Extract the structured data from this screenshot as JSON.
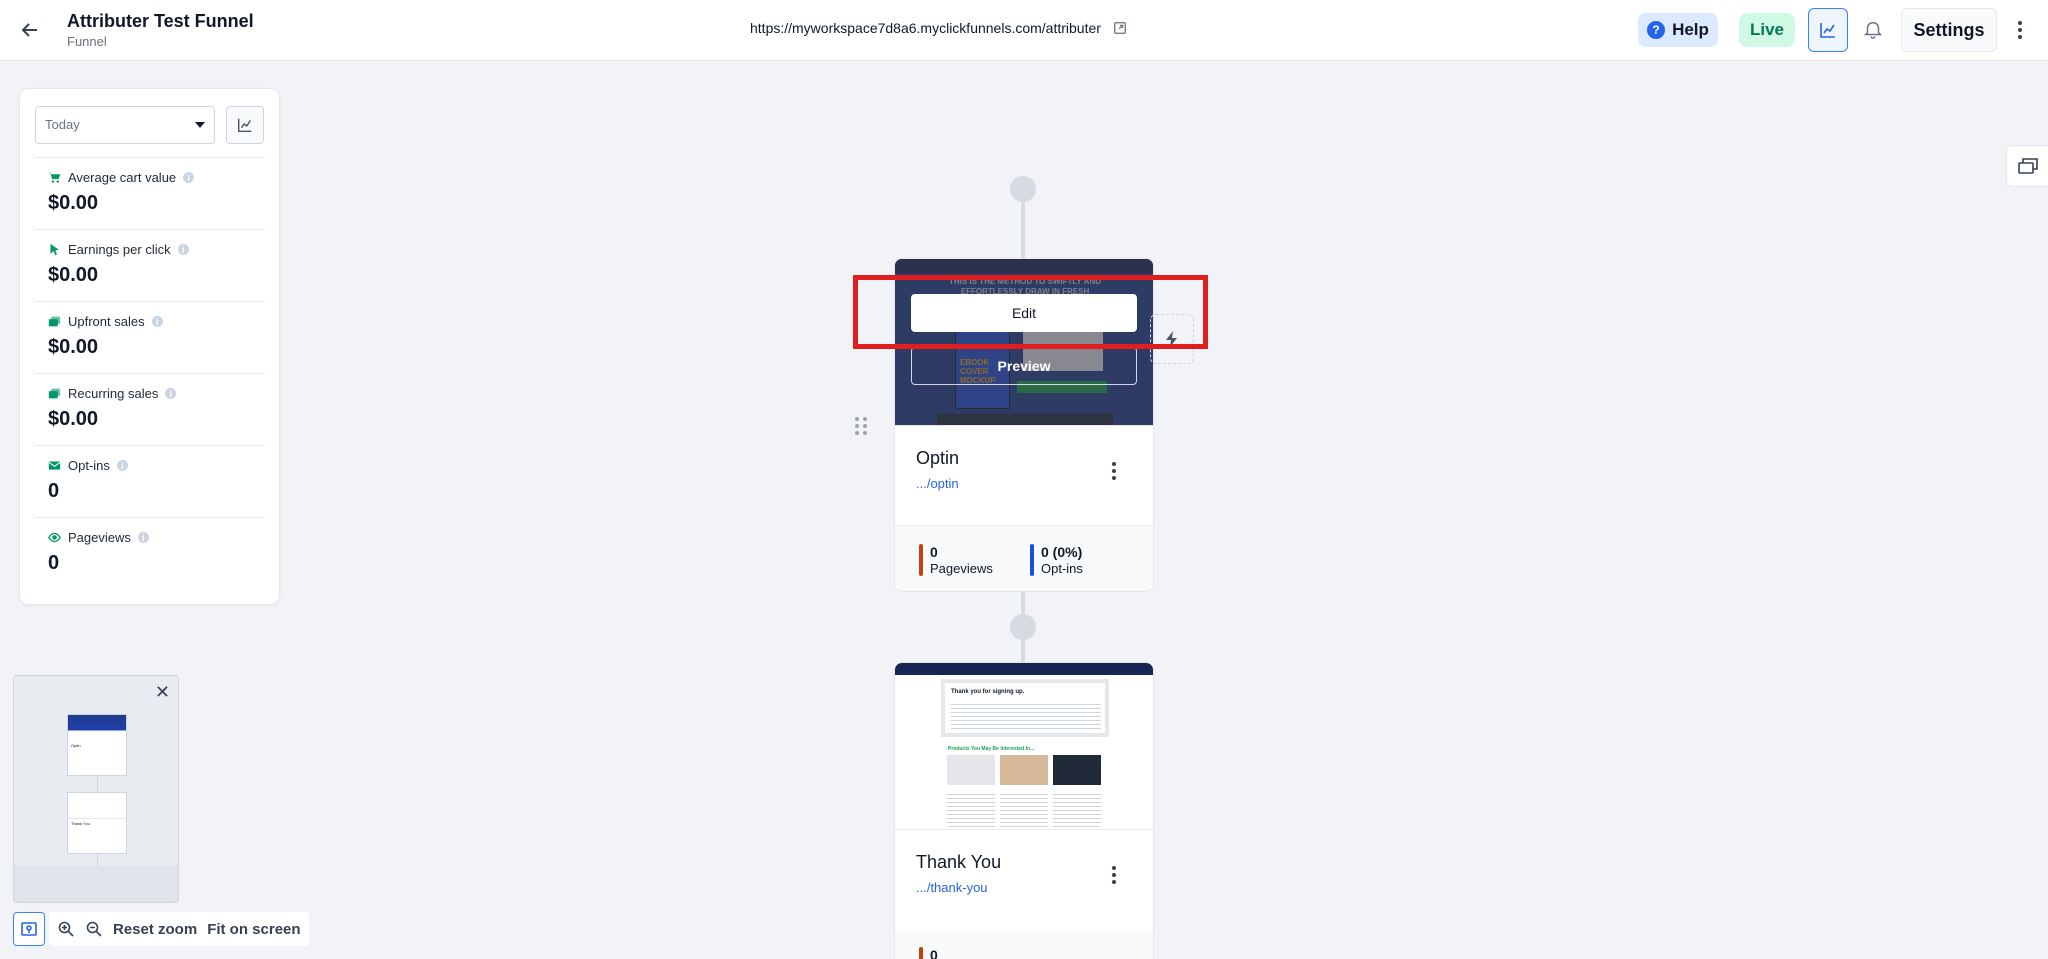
{
  "header": {
    "title": "Attributer Test Funnel",
    "subtitle": "Funnel",
    "url": "https://myworkspace7d8a6.myclickfunnels.com/attributer",
    "help_label": "Help",
    "help_q": "?",
    "live_label": "Live",
    "settings_label": "Settings"
  },
  "stats": {
    "date_range": "Today",
    "metrics": [
      {
        "label": "Average cart value",
        "value": "$0.00",
        "icon": "cart-icon"
      },
      {
        "label": "Earnings per click",
        "value": "$0.00",
        "icon": "cursor-icon"
      },
      {
        "label": "Upfront sales",
        "value": "$0.00",
        "icon": "money-icon"
      },
      {
        "label": "Recurring sales",
        "value": "$0.00",
        "icon": "money-icon"
      },
      {
        "label": "Opt-ins",
        "value": "0",
        "icon": "mail-icon"
      },
      {
        "label": "Pageviews",
        "value": "0",
        "icon": "eye-icon"
      }
    ],
    "info_glyph": "i"
  },
  "canvas": {
    "steps": [
      {
        "name": "Optin",
        "path": ".../optin",
        "edit_label": "Edit",
        "preview_label": "Preview",
        "pageviews_value": "0",
        "pageviews_label": "Pageviews",
        "optins_value": "0 (0%)",
        "optins_label": "Opt-ins"
      },
      {
        "name": "Thank You",
        "path": ".../thank-you",
        "pageviews_value": "0"
      }
    ]
  },
  "minimap": {
    "close": "✕",
    "labels": [
      "Optin",
      "Thank You"
    ]
  },
  "zoom": {
    "reset_label": "Reset zoom",
    "fit_label": "Fit on screen"
  },
  "colors": {
    "accent": "#2563eb",
    "live_green": "#047857",
    "highlight": "#e11d1d",
    "pageviews_bar": "#c2410c",
    "optins_bar": "#1d4ed8"
  }
}
